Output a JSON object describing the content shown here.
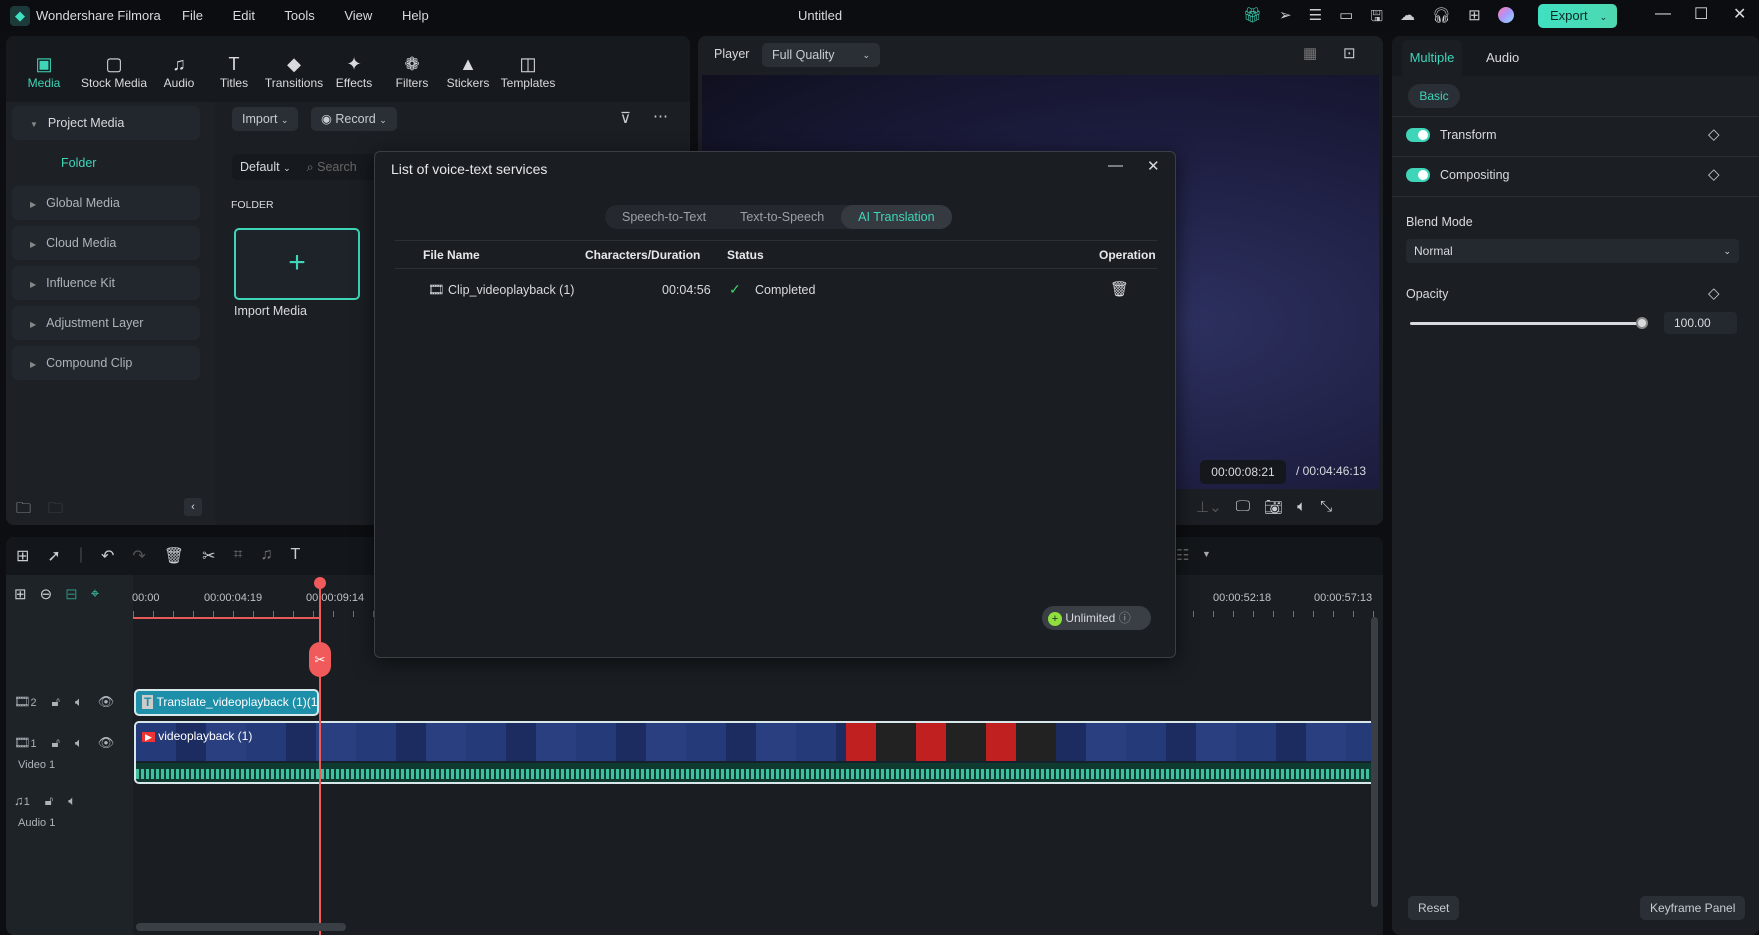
{
  "app": {
    "name": "Wondershare Filmora",
    "document_title": "Untitled",
    "menu": [
      "File",
      "Edit",
      "Tools",
      "View",
      "Help"
    ],
    "export_label": "Export",
    "accent": "#3fd5b8"
  },
  "media_tabs": [
    {
      "label": "Media",
      "icon": "media-icon",
      "active": true
    },
    {
      "label": "Stock Media",
      "icon": "stock-media-icon"
    },
    {
      "label": "Audio",
      "icon": "music-note-icon"
    },
    {
      "label": "Titles",
      "icon": "titles-icon"
    },
    {
      "label": "Transitions",
      "icon": "transitions-icon"
    },
    {
      "label": "Effects",
      "icon": "effects-icon"
    },
    {
      "label": "Filters",
      "icon": "filters-icon"
    },
    {
      "label": "Stickers",
      "icon": "stickers-icon"
    },
    {
      "label": "Templates",
      "icon": "templates-icon"
    }
  ],
  "sidebar": {
    "project_media": "Project Media",
    "folder": "Folder",
    "items": [
      "Global Media",
      "Cloud Media",
      "Influence Kit",
      "Adjustment Layer",
      "Compound Clip"
    ]
  },
  "media": {
    "import": "Import",
    "record": "Record",
    "sort": "Default",
    "search_placeholder": "Search",
    "folder_heading": "FOLDER",
    "import_media": "Import Media"
  },
  "player": {
    "label": "Player",
    "quality": "Full Quality",
    "current_time": "00:00:08:21",
    "total_time": "00:04:46:13"
  },
  "right_panel": {
    "tabs": [
      "Multiple",
      "Audio"
    ],
    "subtab": "Basic",
    "transform": "Transform",
    "compositing": "Compositing",
    "blend_mode_label": "Blend Mode",
    "blend_mode": "Normal",
    "opacity_label": "Opacity",
    "opacity_value": "100.00",
    "opacity_percent": 100,
    "reset": "Reset",
    "keyframe_panel": "Keyframe Panel"
  },
  "timeline": {
    "ruler": [
      "00:00",
      "00:00:04:19",
      "00:00:09:14",
      "00:00:52:18",
      "00:00:57:13"
    ],
    "tracks": {
      "text_track": "2",
      "video_track": "1",
      "video_name": "Video 1",
      "audio_track": "1",
      "audio_name": "Audio 1"
    },
    "clips": {
      "text": "Translate_videoplayback (1)(1)",
      "video": "videoplayback (1)"
    }
  },
  "dialog": {
    "title": "List of voice-text services",
    "tabs": [
      "Speech-to-Text",
      "Text-to-Speech",
      "AI Translation"
    ],
    "active_tab": "AI Translation",
    "columns": [
      "File Name",
      "Characters/Duration",
      "Status",
      "Operation"
    ],
    "rows": [
      {
        "file": "Clip_videoplayback (1)",
        "duration": "00:04:56",
        "status": "Completed"
      }
    ],
    "plan": "Unlimited"
  }
}
